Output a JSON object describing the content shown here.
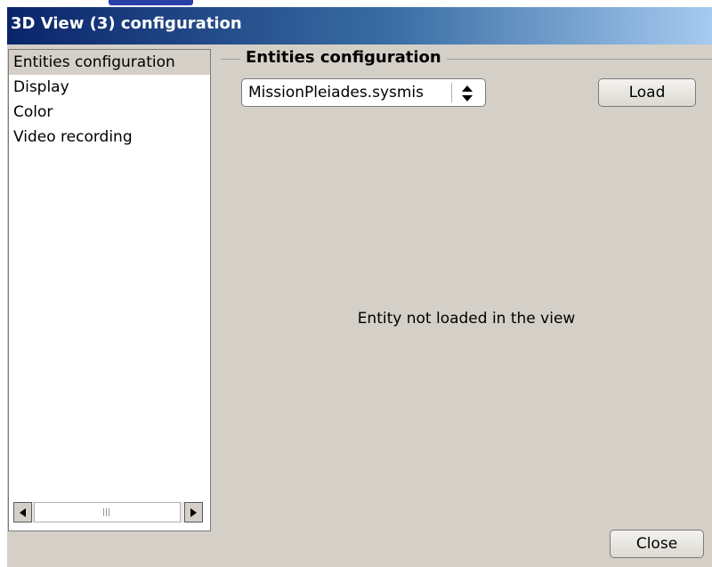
{
  "window": {
    "title": "3D View (3) configuration"
  },
  "sidebar": {
    "items": [
      {
        "label": "Entities configuration",
        "selected": true
      },
      {
        "label": "Display",
        "selected": false
      },
      {
        "label": "Color",
        "selected": false
      },
      {
        "label": "Video recording",
        "selected": false
      }
    ]
  },
  "group": {
    "title": "Entities configuration"
  },
  "entity_select": {
    "value": "MissionPleiades.sysmis"
  },
  "buttons": {
    "load_label": "Load",
    "close_label": "Close"
  },
  "status": {
    "message": "Entity not loaded in the view"
  },
  "colors": {
    "titlebar_start": "#0a246a",
    "titlebar_end": "#a6caf0",
    "dialog_background": "#d4d0c8"
  }
}
